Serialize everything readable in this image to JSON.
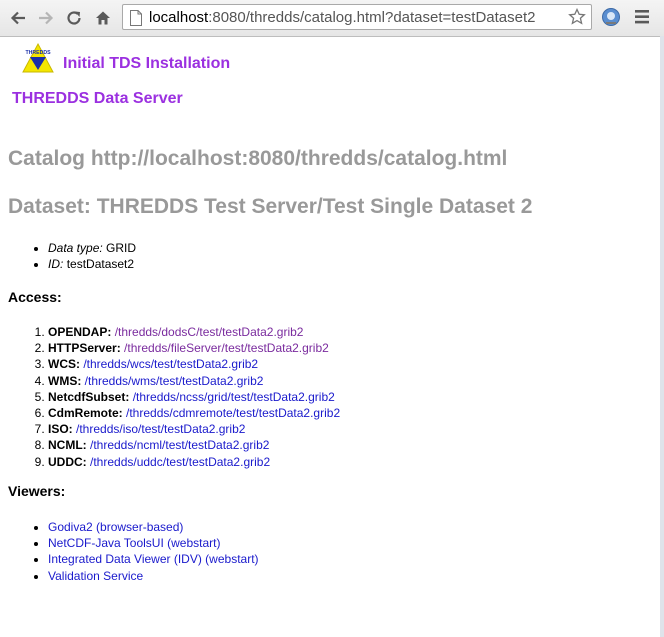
{
  "browser": {
    "url_host": "localhost",
    "url_rest": ":8080/thredds/catalog.html?dataset=testDataset2"
  },
  "header": {
    "logo_text": "THREDDS",
    "install_title": "Initial TDS Installation",
    "server_title": "THREDDS Data Server"
  },
  "catalog_heading": "Catalog http://localhost:8080/thredds/catalog.html",
  "dataset_heading": "Dataset: THREDDS Test Server/Test Single Dataset 2",
  "properties": [
    {
      "label": "Data type:",
      "value": "GRID"
    },
    {
      "label": "ID:",
      "value": "testDataset2"
    }
  ],
  "access": {
    "heading": "Access:",
    "services": [
      {
        "service": "OPENDAP:",
        "path": "/thredds/dodsC/test/testData2.grib2"
      },
      {
        "service": "HTTPServer:",
        "path": "/thredds/fileServer/test/testData2.grib2"
      },
      {
        "service": "WCS:",
        "path": "/thredds/wcs/test/testData2.grib2"
      },
      {
        "service": "WMS:",
        "path": "/thredds/wms/test/testData2.grib2"
      },
      {
        "service": "NetcdfSubset:",
        "path": "/thredds/ncss/grid/test/testData2.grib2"
      },
      {
        "service": "CdmRemote:",
        "path": "/thredds/cdmremote/test/testData2.grib2"
      },
      {
        "service": "ISO:",
        "path": "/thredds/iso/test/testData2.grib2"
      },
      {
        "service": "NCML:",
        "path": "/thredds/ncml/test/testData2.grib2"
      },
      {
        "service": "UDDC:",
        "path": "/thredds/uddc/test/testData2.grib2"
      }
    ]
  },
  "viewers": {
    "heading": "Viewers:",
    "items": [
      "Godiva2 (browser-based)",
      "NetCDF-Java ToolsUI (webstart)",
      "Integrated Data Viewer (IDV) (webstart)",
      "Validation Service"
    ]
  },
  "colors": {
    "title_purple": "#9b30e0",
    "heading_gray": "#999999",
    "link_blue": "#1a1acc",
    "visited_purple": "#7a2b9e"
  },
  "icons": [
    "back-icon",
    "forward-icon",
    "reload-icon",
    "home-icon",
    "page-icon",
    "star-icon",
    "extension-icon",
    "menu-icon",
    "thredds-logo"
  ]
}
